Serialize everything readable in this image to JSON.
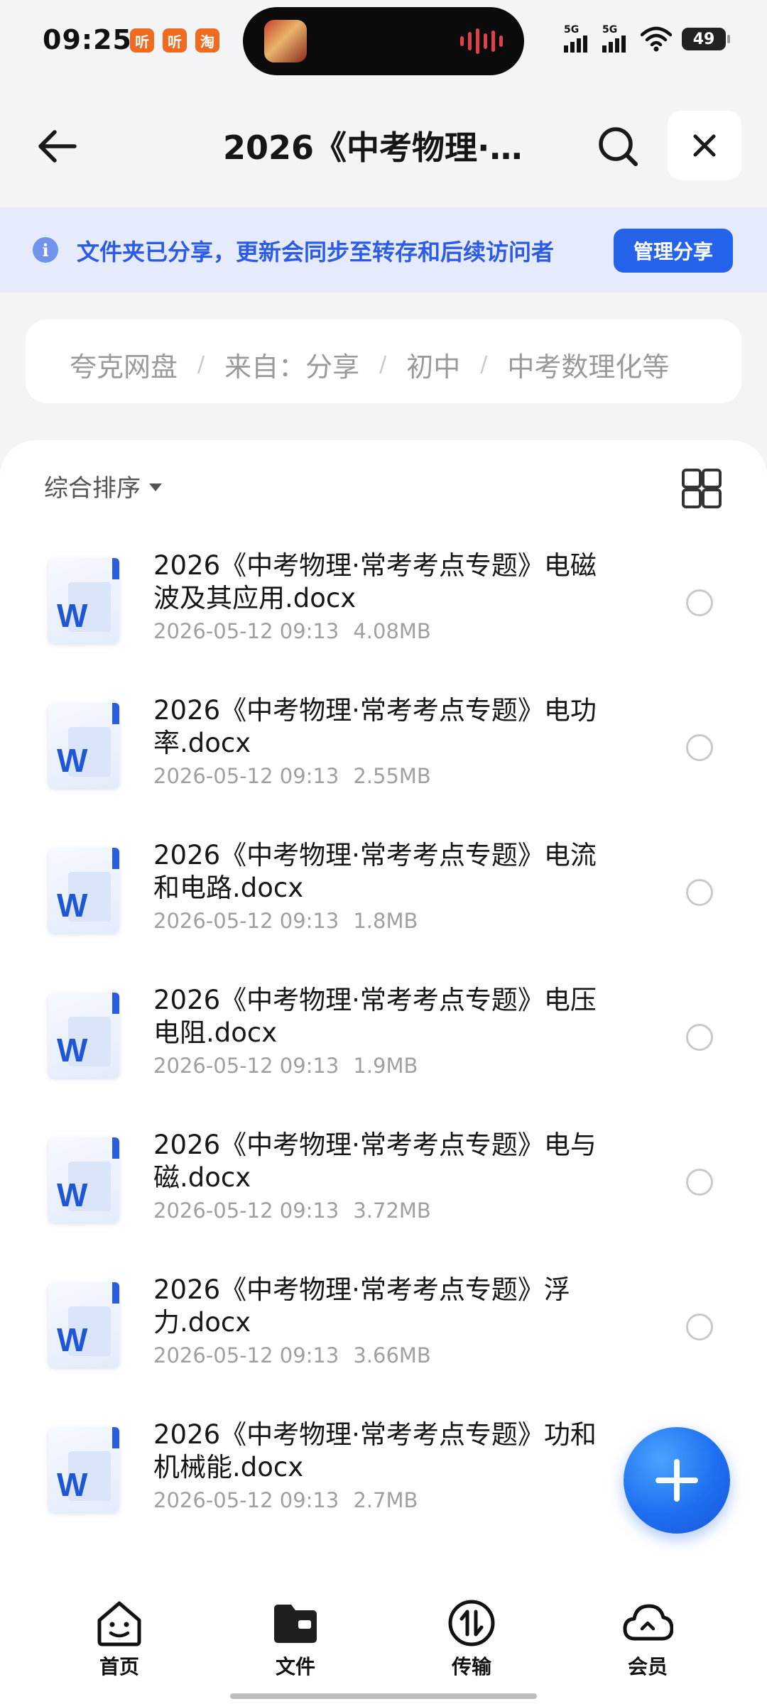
{
  "status_bar": {
    "time": "09:25",
    "app_badges": [
      "听",
      "听",
      "淘"
    ],
    "signal_labels": [
      "5G",
      "5G"
    ],
    "battery": "49"
  },
  "header": {
    "title": "2026《中考物理·…",
    "back_icon": "arrow-left-icon",
    "search_icon": "search-icon",
    "close_icon": "close-icon"
  },
  "share_banner": {
    "text": "文件夹已分享，更新会同步至转存和后续访问者",
    "button": "管理分享"
  },
  "breadcrumb": [
    "夸克网盘",
    "来自：分享",
    "初中",
    "中考数理化等"
  ],
  "sort": {
    "label": "综合排序"
  },
  "files": [
    {
      "name": "2026《中考物理·常考考点专题》电磁波及其应用.docx",
      "date": "2026-05-12 09:13",
      "size": "4.08MB"
    },
    {
      "name": "2026《中考物理·常考考点专题》电功率.docx",
      "date": "2026-05-12 09:13",
      "size": "2.55MB"
    },
    {
      "name": "2026《中考物理·常考考点专题》电流和电路.docx",
      "date": "2026-05-12 09:13",
      "size": "1.8MB"
    },
    {
      "name": "2026《中考物理·常考考点专题》电压 电阻.docx",
      "date": "2026-05-12 09:13",
      "size": "1.9MB"
    },
    {
      "name": "2026《中考物理·常考考点专题》电与磁.docx",
      "date": "2026-05-12 09:13",
      "size": "3.72MB"
    },
    {
      "name": "2026《中考物理·常考考点专题》浮力.docx",
      "date": "2026-05-12 09:13",
      "size": "3.66MB"
    },
    {
      "name": "2026《中考物理·常考考点专题》功和机械能.docx",
      "date": "2026-05-12 09:13",
      "size": "2.7MB"
    }
  ],
  "nav": {
    "items": [
      {
        "label": "首页",
        "icon": "home-face-icon"
      },
      {
        "label": "文件",
        "icon": "folder-icon"
      },
      {
        "label": "传输",
        "icon": "transfer-icon"
      },
      {
        "label": "会员",
        "icon": "cloud-icon"
      }
    ],
    "active": "文件"
  },
  "colors": {
    "accent": "#2563eb",
    "banner_bg": "#e6ebfb",
    "banner_text": "#2c5be6"
  }
}
